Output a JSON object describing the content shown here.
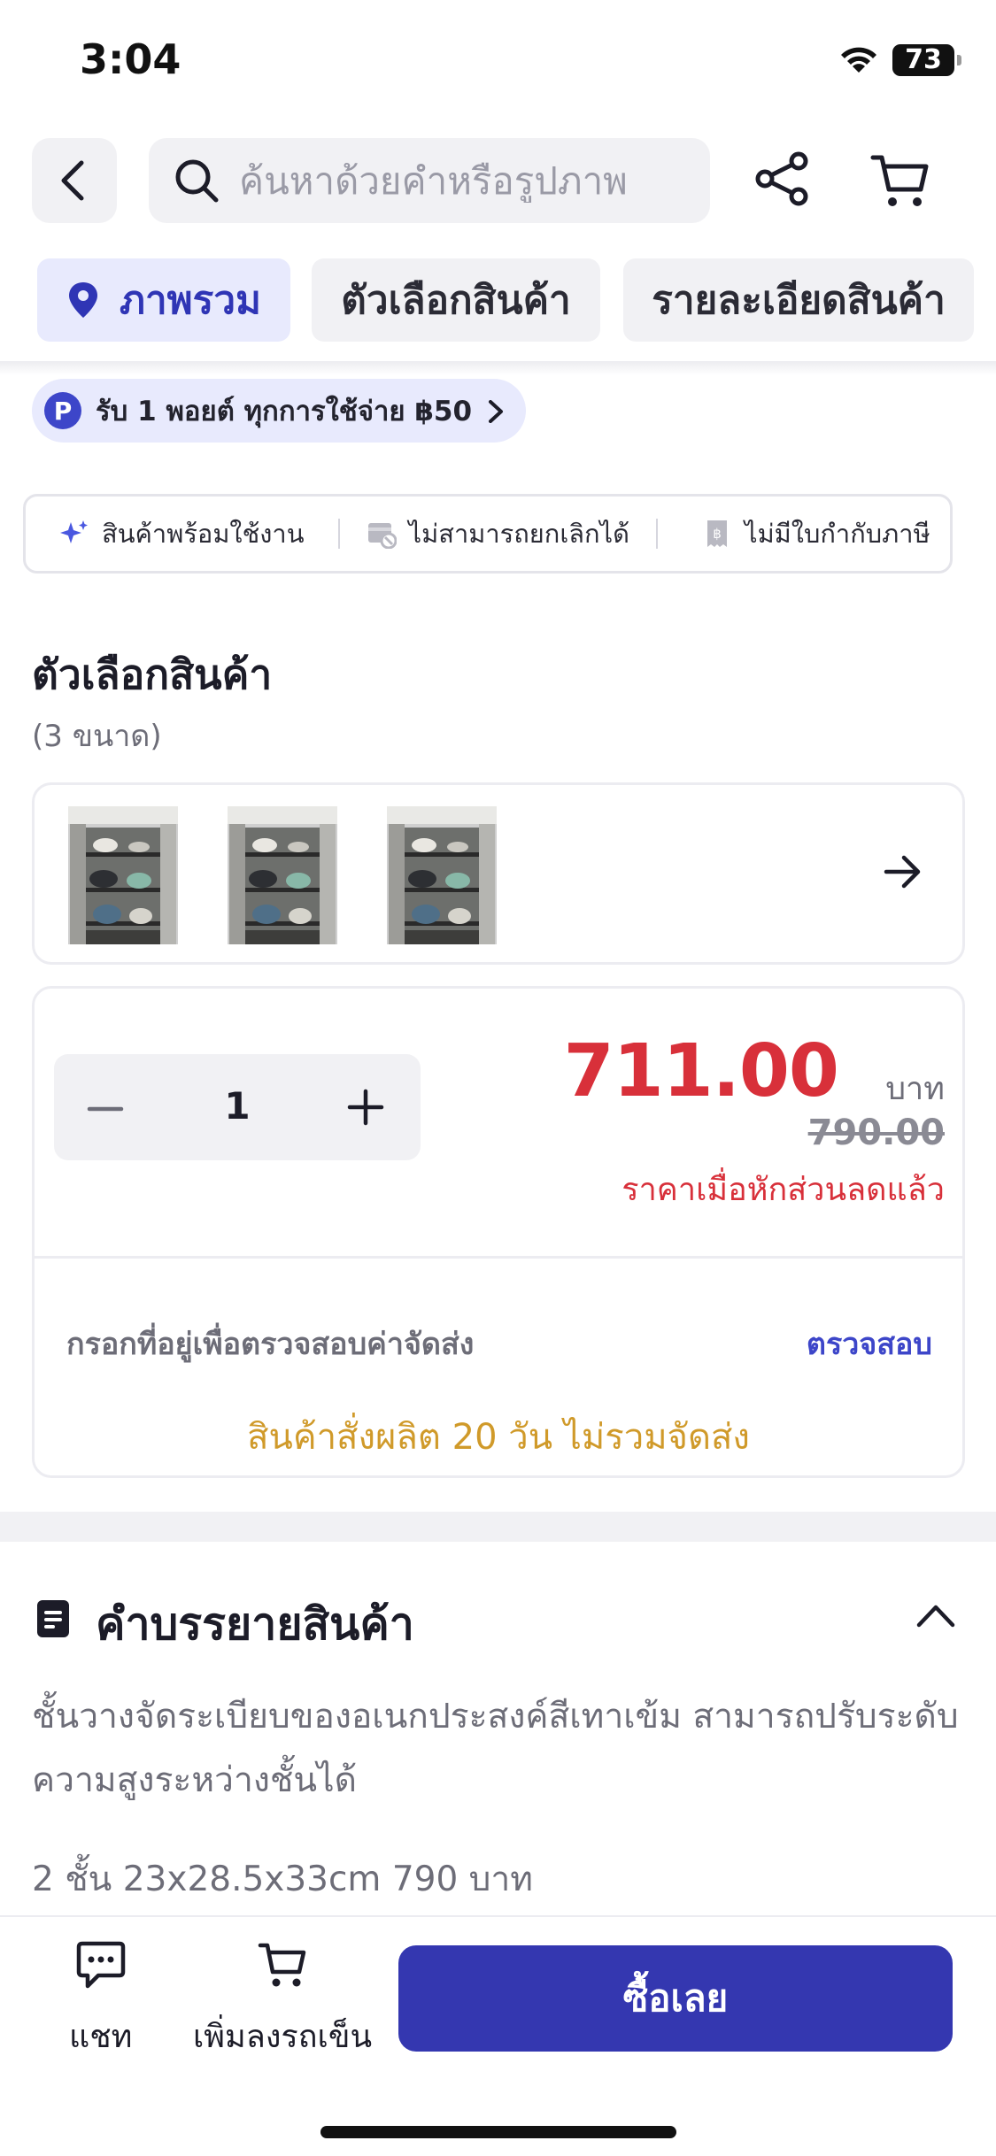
{
  "status_bar": {
    "time": "3:04",
    "battery": "73"
  },
  "top_bar": {
    "search_placeholder": "ค้นหาด้วยคำหรือรูปภาพ"
  },
  "tabs": [
    {
      "label": "ภาพรวม",
      "active": true
    },
    {
      "label": "ตัวเลือกสินค้า",
      "active": false
    },
    {
      "label": "รายละเอียดสินค้า",
      "active": false
    }
  ],
  "points_banner": {
    "badge": "P",
    "text": "รับ 1 พอยต์ ทุกการใช้จ่าย ฿50"
  },
  "badges": [
    {
      "label": "สินค้าพร้อมใช้งาน",
      "icon": "sparkle-icon"
    },
    {
      "label": "ไม่สามารถยกเลิกได้",
      "icon": "no-cancel-icon"
    },
    {
      "label": "ไม่มีใบกำกับภาษี",
      "icon": "receipt-icon"
    }
  ],
  "variants": {
    "title": "ตัวเลือกสินค้า",
    "count_text": "(3 ขนาด)",
    "thumbnails": [
      "shelf-photo-1",
      "shelf-photo-2",
      "shelf-photo-3"
    ]
  },
  "price_card": {
    "quantity": "1",
    "price": "711.00",
    "currency": "บาท",
    "original_price": "790.00",
    "discount_note": "ราคาเมื่อหักส่วนลดแล้ว",
    "shipping_label": "กรอกที่อยู่เพื่อตรวจสอบค่าจัดส่ง",
    "check_link": "ตรวจสอบ",
    "lead_time": "สินค้าสั่งผลิต 20 วัน ไม่รวมจัดส่ง"
  },
  "description": {
    "title": "คำบรรยายสินค้า",
    "text": "ชั้นวางจัดระเบียบของอเนกประสงค์สีเทาเข้ม สามารถปรับระดับความสูงระหว่างชั้นได้",
    "spec": "2 ชั้น 23x28.5x33cm 790 บาท"
  },
  "bottom_bar": {
    "chat_label": "แชท",
    "add_to_cart_label": "เพิ่มลงรถเข็น",
    "buy_label": "ซื้อเลย"
  },
  "colors": {
    "accent": "#3437b0",
    "price_red": "#d8303a",
    "link_blue": "#3d46c9",
    "lead_time_gold": "#d09a2a"
  }
}
